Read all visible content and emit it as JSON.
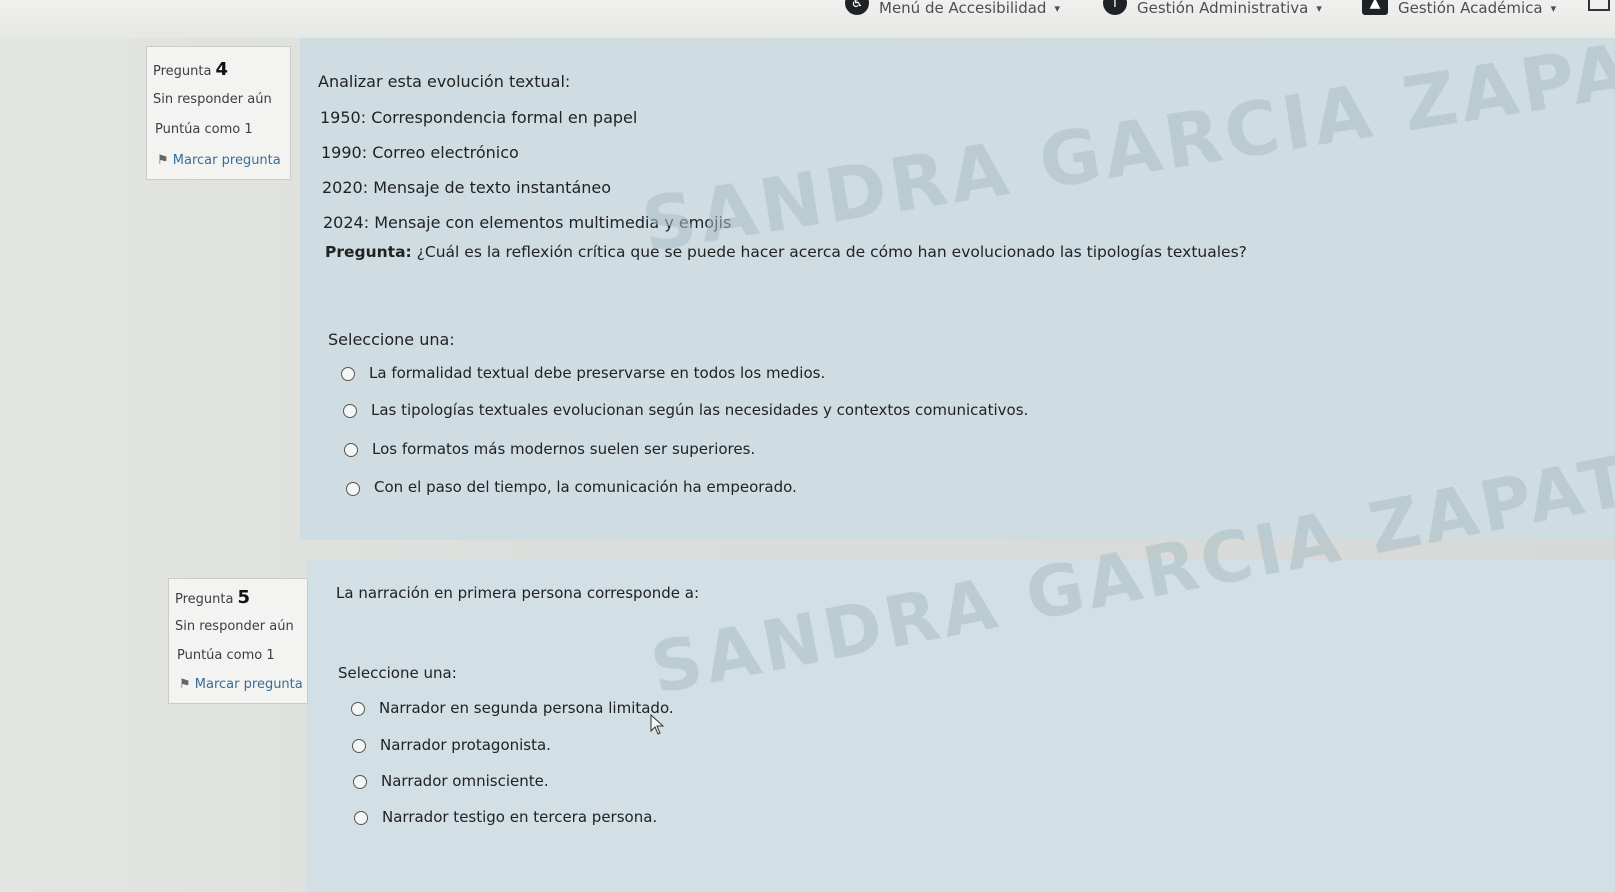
{
  "topbar": {
    "accessibility_menu": "Menú de Accesibilidad",
    "admin_menu": "Gestión Administrativa",
    "academic_menu": "Gestión Académica"
  },
  "icons": {
    "accessibility": "accessibility-icon",
    "info": "info-icon",
    "academic": "graduation-cap-icon",
    "mail": "mail-icon",
    "flag": "flag-icon"
  },
  "question4": {
    "label": "Pregunta",
    "number": "4",
    "status": "Sin responder aún",
    "score": "Puntúa como 1",
    "flag_label": "Marcar pregunta",
    "intro": "Analizar esta evolución textual:",
    "timeline": [
      "1950: Correspondencia formal en papel",
      "1990: Correo electrónico",
      "2020: Mensaje de texto instantáneo",
      "2024: Mensaje con elementos multimedia y emojis"
    ],
    "question_bold": "Pregunta:",
    "question_text": " ¿Cuál es la reflexión crítica que se puede hacer acerca de cómo han evolucionado las tipologías textuales?",
    "select_label": "Seleccione una:",
    "options": [
      "La formalidad textual debe preservarse en todos los medios.",
      "Las tipologías textuales evolucionan según las necesidades y contextos comunicativos.",
      "Los formatos más modernos suelen ser superiores.",
      "Con el paso del tiempo, la comunicación ha empeorado."
    ]
  },
  "question5": {
    "label": "Pregunta",
    "number": "5",
    "status": "Sin responder aún",
    "score": "Puntúa como 1",
    "flag_label": "Marcar pregunta",
    "question_text": "La narración en primera persona corresponde a:",
    "select_label": "Seleccione una:",
    "options": [
      "Narrador en segunda persona limitado.",
      "Narrador protagonista.",
      "Narrador omnisciente.",
      "Narrador testigo en tercera persona."
    ]
  },
  "watermark": "SANDRA GARCIA ZAPATA"
}
